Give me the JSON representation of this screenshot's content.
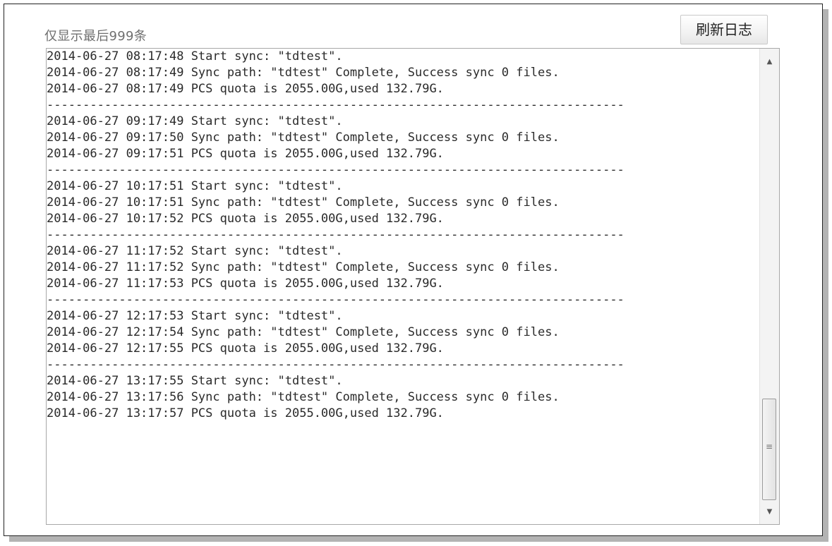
{
  "header": {
    "hint": "仅显示最后999条",
    "refresh_label": "刷新日志"
  },
  "log": {
    "text": "2014-06-27 08:17:48 Start sync: \"tdtest\".\n2014-06-27 08:17:49 Sync path: \"tdtest\" Complete, Success sync 0 files.\n2014-06-27 08:17:49 PCS quota is 2055.00G,used 132.79G.\n--------------------------------------------------------------------------------\n2014-06-27 09:17:49 Start sync: \"tdtest\".\n2014-06-27 09:17:50 Sync path: \"tdtest\" Complete, Success sync 0 files.\n2014-06-27 09:17:51 PCS quota is 2055.00G,used 132.79G.\n--------------------------------------------------------------------------------\n2014-06-27 10:17:51 Start sync: \"tdtest\".\n2014-06-27 10:17:51 Sync path: \"tdtest\" Complete, Success sync 0 files.\n2014-06-27 10:17:52 PCS quota is 2055.00G,used 132.79G.\n--------------------------------------------------------------------------------\n2014-06-27 11:17:52 Start sync: \"tdtest\".\n2014-06-27 11:17:52 Sync path: \"tdtest\" Complete, Success sync 0 files.\n2014-06-27 11:17:53 PCS quota is 2055.00G,used 132.79G.\n--------------------------------------------------------------------------------\n2014-06-27 12:17:53 Start sync: \"tdtest\".\n2014-06-27 12:17:54 Sync path: \"tdtest\" Complete, Success sync 0 files.\n2014-06-27 12:17:55 PCS quota is 2055.00G,used 132.79G.\n--------------------------------------------------------------------------------\n2014-06-27 13:17:55 Start sync: \"tdtest\".\n2014-06-27 13:17:56 Sync path: \"tdtest\" Complete, Success sync 0 files.\n2014-06-27 13:17:57 PCS quota is 2055.00G,used 132.79G."
  },
  "scrollbar": {
    "up_icon": "▲",
    "down_icon": "▼",
    "grip_icon": "≡"
  },
  "colors": {
    "text": "#2a2a2a",
    "hint": "#6f6f6f",
    "border": "#a8a8a8"
  }
}
